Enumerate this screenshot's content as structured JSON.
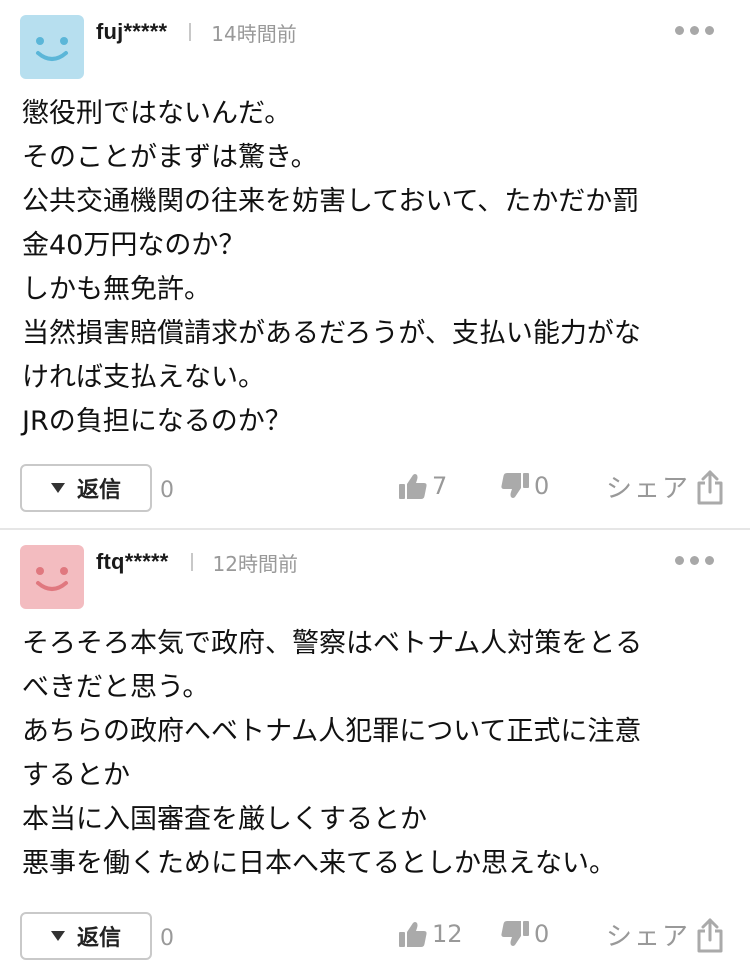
{
  "comments": [
    {
      "username": "fuj*****",
      "time": "14時間前",
      "avatar_color": "#b7dfef",
      "avatar_face_color": "#5bb6d8",
      "lines": [
        "懲役刑ではないんだ。",
        "そのことがまずは驚き。",
        "公共交通機関の往来を妨害しておいて、たかだか罰",
        "金40万円なのか？",
        "しかも無免許。",
        "当然損害賠償請求があるだろうが、支払い能力がな",
        "ければ支払えない。",
        "JRの負担になるのか？"
      ],
      "reply_label": "返信",
      "reply_count": "0",
      "likes": "7",
      "dislikes": "0",
      "share_label": "シェア"
    },
    {
      "username": "ftq*****",
      "time": "12時間前",
      "avatar_color": "#f3bcc0",
      "avatar_face_color": "#e0787f",
      "lines": [
        "そろそろ本気で政府、警察はベトナム人対策をとる",
        "べきだと思う。",
        "あちらの政府へベトナム人犯罪について正式に注意",
        "するとか",
        "本当に入国審査を厳しくするとか",
        "悪事を働くために日本へ来てるとしか思えない。"
      ],
      "reply_label": "返信",
      "reply_count": "0",
      "likes": "12",
      "dislikes": "0",
      "share_label": "シェア"
    }
  ]
}
